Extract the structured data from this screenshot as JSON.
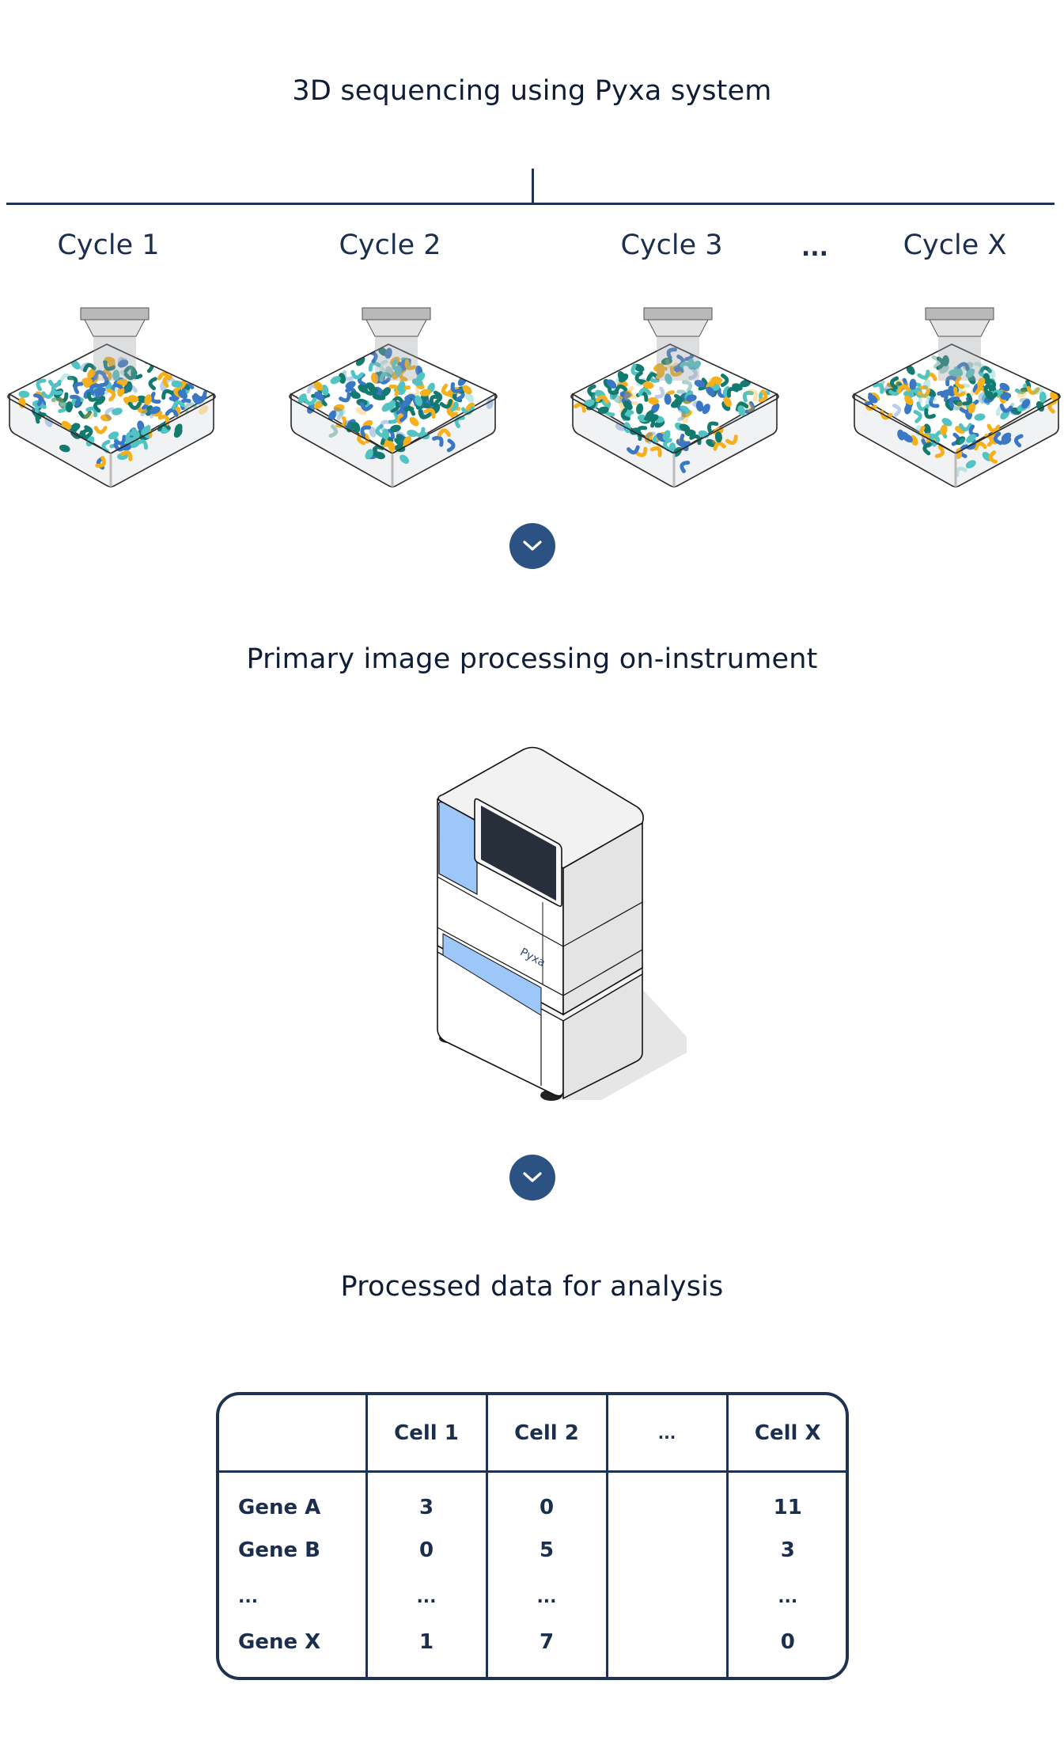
{
  "sections": {
    "sequencing_title": "3D sequencing using Pyxa system",
    "processing_title": "Primary image processing on-instrument",
    "analysis_title": "Processed data for analysis"
  },
  "cycles": [
    {
      "label": "Cycle 1"
    },
    {
      "label": "Cycle 2"
    },
    {
      "label": "Cycle 3"
    },
    {
      "label": "Cycle X"
    }
  ],
  "cycle_ellipsis": "...",
  "instrument": {
    "brand": "Pyxa"
  },
  "colors": {
    "navy": "#1f3251",
    "button": "#2c5283",
    "panel_blue": "#9ec7f9",
    "screen": "#262f3a",
    "bead_teal_dark": "#137a6f",
    "bead_teal_light": "#52c3c3",
    "bead_blue": "#3a77c4",
    "bead_yellow": "#f5b01c"
  },
  "table": {
    "corner_header": "",
    "columns": [
      "Cell 1",
      "Cell 2",
      "...",
      "Cell X"
    ],
    "rows": [
      {
        "gene": "Gene A",
        "values": [
          "3",
          "0",
          "",
          "11"
        ]
      },
      {
        "gene": "Gene B",
        "values": [
          "0",
          "5",
          "",
          "3"
        ]
      },
      {
        "gene": "...",
        "values": [
          "...",
          "...",
          "",
          "..."
        ]
      },
      {
        "gene": "Gene X",
        "values": [
          "1",
          "7",
          "",
          "0"
        ]
      }
    ]
  }
}
